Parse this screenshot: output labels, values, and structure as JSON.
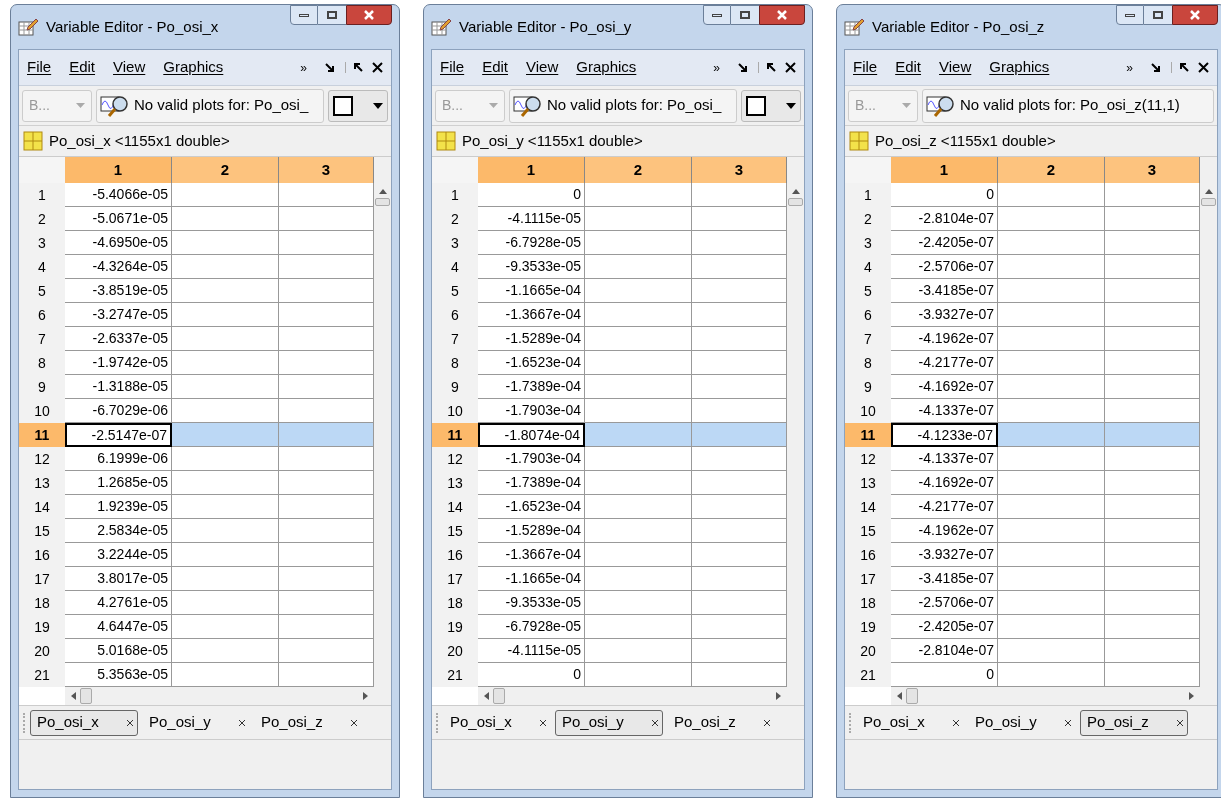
{
  "windows": [
    {
      "title": "Variable Editor - Po_osi_x",
      "menu": [
        "File",
        "Edit",
        "View",
        "Graphics"
      ],
      "overflow": "»",
      "toolbar_button": "B...",
      "plot_status": "No valid plots for: Po_osi_",
      "kind": "with_swatch",
      "variable": "Po_osi_x <1155x1 double>",
      "columns": [
        {
          "label": "1",
          "selected": true
        },
        {
          "label": "2",
          "selected": false
        },
        {
          "label": "3",
          "selected": false
        }
      ],
      "rows": [
        {
          "index": "1",
          "value": "-5.4066e-05",
          "selected": false
        },
        {
          "index": "2",
          "value": "-5.0671e-05",
          "selected": false
        },
        {
          "index": "3",
          "value": "-4.6950e-05",
          "selected": false
        },
        {
          "index": "4",
          "value": "-4.3264e-05",
          "selected": false
        },
        {
          "index": "5",
          "value": "-3.8519e-05",
          "selected": false
        },
        {
          "index": "6",
          "value": "-3.2747e-05",
          "selected": false
        },
        {
          "index": "7",
          "value": "-2.6337e-05",
          "selected": false
        },
        {
          "index": "8",
          "value": "-1.9742e-05",
          "selected": false
        },
        {
          "index": "9",
          "value": "-1.3188e-05",
          "selected": false
        },
        {
          "index": "10",
          "value": "-6.7029e-06",
          "selected": false
        },
        {
          "index": "11",
          "value": "-2.5147e-07",
          "selected": true
        },
        {
          "index": "12",
          "value": "6.1999e-06",
          "selected": false
        },
        {
          "index": "13",
          "value": "1.2685e-05",
          "selected": false
        },
        {
          "index": "14",
          "value": "1.9239e-05",
          "selected": false
        },
        {
          "index": "15",
          "value": "2.5834e-05",
          "selected": false
        },
        {
          "index": "16",
          "value": "3.2244e-05",
          "selected": false
        },
        {
          "index": "17",
          "value": "3.8017e-05",
          "selected": false
        },
        {
          "index": "18",
          "value": "4.2761e-05",
          "selected": false
        },
        {
          "index": "19",
          "value": "4.6447e-05",
          "selected": false
        },
        {
          "index": "20",
          "value": "5.0168e-05",
          "selected": false
        },
        {
          "index": "21",
          "value": "5.3563e-05",
          "selected": false
        }
      ],
      "tabs": [
        {
          "label": "Po_osi_x",
          "selected": true
        },
        {
          "label": "Po_osi_y",
          "selected": false
        },
        {
          "label": "Po_osi_z",
          "selected": false
        }
      ]
    },
    {
      "title": "Variable Editor - Po_osi_y",
      "menu": [
        "File",
        "Edit",
        "View",
        "Graphics"
      ],
      "overflow": "»",
      "toolbar_button": "B...",
      "plot_status": "No valid plots for: Po_osi_",
      "kind": "with_swatch",
      "variable": "Po_osi_y <1155x1 double>",
      "columns": [
        {
          "label": "1",
          "selected": true
        },
        {
          "label": "2",
          "selected": false
        },
        {
          "label": "3",
          "selected": false
        }
      ],
      "rows": [
        {
          "index": "1",
          "value": "0",
          "selected": false
        },
        {
          "index": "2",
          "value": "-4.1115e-05",
          "selected": false
        },
        {
          "index": "3",
          "value": "-6.7928e-05",
          "selected": false
        },
        {
          "index": "4",
          "value": "-9.3533e-05",
          "selected": false
        },
        {
          "index": "5",
          "value": "-1.1665e-04",
          "selected": false
        },
        {
          "index": "6",
          "value": "-1.3667e-04",
          "selected": false
        },
        {
          "index": "7",
          "value": "-1.5289e-04",
          "selected": false
        },
        {
          "index": "8",
          "value": "-1.6523e-04",
          "selected": false
        },
        {
          "index": "9",
          "value": "-1.7389e-04",
          "selected": false
        },
        {
          "index": "10",
          "value": "-1.7903e-04",
          "selected": false
        },
        {
          "index": "11",
          "value": "-1.8074e-04",
          "selected": true
        },
        {
          "index": "12",
          "value": "-1.7903e-04",
          "selected": false
        },
        {
          "index": "13",
          "value": "-1.7389e-04",
          "selected": false
        },
        {
          "index": "14",
          "value": "-1.6523e-04",
          "selected": false
        },
        {
          "index": "15",
          "value": "-1.5289e-04",
          "selected": false
        },
        {
          "index": "16",
          "value": "-1.3667e-04",
          "selected": false
        },
        {
          "index": "17",
          "value": "-1.1665e-04",
          "selected": false
        },
        {
          "index": "18",
          "value": "-9.3533e-05",
          "selected": false
        },
        {
          "index": "19",
          "value": "-6.7928e-05",
          "selected": false
        },
        {
          "index": "20",
          "value": "-4.1115e-05",
          "selected": false
        },
        {
          "index": "21",
          "value": "0",
          "selected": false
        }
      ],
      "tabs": [
        {
          "label": "Po_osi_x",
          "selected": false
        },
        {
          "label": "Po_osi_y",
          "selected": true
        },
        {
          "label": "Po_osi_z",
          "selected": false
        }
      ]
    },
    {
      "title": "Variable Editor - Po_osi_z",
      "menu": [
        "File",
        "Edit",
        "View",
        "Graphics"
      ],
      "overflow": "»",
      "toolbar_button": "B...",
      "plot_status": "No valid plots for: Po_osi_z(11,1)",
      "kind": "plain",
      "variable": "Po_osi_z <1155x1 double>",
      "columns": [
        {
          "label": "1",
          "selected": true
        },
        {
          "label": "2",
          "selected": false
        },
        {
          "label": "3",
          "selected": false
        }
      ],
      "rows": [
        {
          "index": "1",
          "value": "0",
          "selected": false
        },
        {
          "index": "2",
          "value": "-2.8104e-07",
          "selected": false
        },
        {
          "index": "3",
          "value": "-2.4205e-07",
          "selected": false
        },
        {
          "index": "4",
          "value": "-2.5706e-07",
          "selected": false
        },
        {
          "index": "5",
          "value": "-3.4185e-07",
          "selected": false
        },
        {
          "index": "6",
          "value": "-3.9327e-07",
          "selected": false
        },
        {
          "index": "7",
          "value": "-4.1962e-07",
          "selected": false
        },
        {
          "index": "8",
          "value": "-4.2177e-07",
          "selected": false
        },
        {
          "index": "9",
          "value": "-4.1692e-07",
          "selected": false
        },
        {
          "index": "10",
          "value": "-4.1337e-07",
          "selected": false
        },
        {
          "index": "11",
          "value": "-4.1233e-07",
          "selected": true
        },
        {
          "index": "12",
          "value": "-4.1337e-07",
          "selected": false
        },
        {
          "index": "13",
          "value": "-4.1692e-07",
          "selected": false
        },
        {
          "index": "14",
          "value": "-4.2177e-07",
          "selected": false
        },
        {
          "index": "15",
          "value": "-4.1962e-07",
          "selected": false
        },
        {
          "index": "16",
          "value": "-3.9327e-07",
          "selected": false
        },
        {
          "index": "17",
          "value": "-3.4185e-07",
          "selected": false
        },
        {
          "index": "18",
          "value": "-2.5706e-07",
          "selected": false
        },
        {
          "index": "19",
          "value": "-2.4205e-07",
          "selected": false
        },
        {
          "index": "20",
          "value": "-2.8104e-07",
          "selected": false
        },
        {
          "index": "21",
          "value": "0",
          "selected": false
        }
      ],
      "tabs": [
        {
          "label": "Po_osi_x",
          "selected": false
        },
        {
          "label": "Po_osi_y",
          "selected": false
        },
        {
          "label": "Po_osi_z",
          "selected": true
        }
      ]
    }
  ]
}
